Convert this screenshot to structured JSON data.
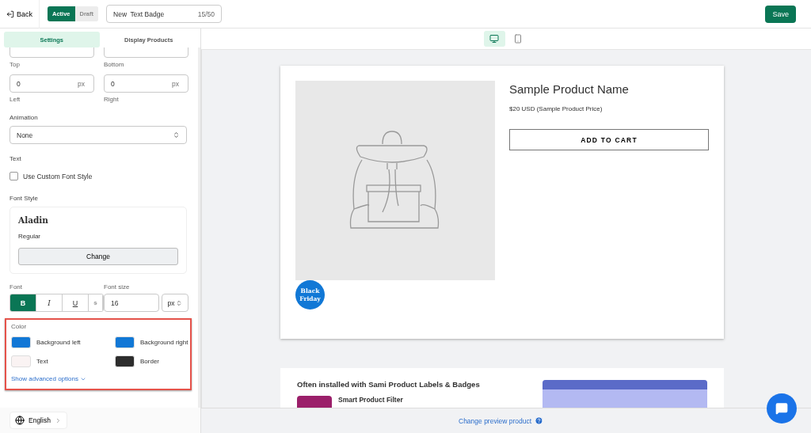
{
  "header": {
    "back": "Back",
    "status": [
      {
        "label": "Active",
        "selected": true
      },
      {
        "label": "Draft",
        "selected": false
      }
    ],
    "name_field": {
      "value": "New  Text Badge",
      "counter": "15/50"
    },
    "save": "Save"
  },
  "sidebar": {
    "tabs": [
      {
        "label": "Settings",
        "selected": true
      },
      {
        "label": "Display Products",
        "selected": false
      }
    ],
    "spacing": [
      {
        "label": "Top"
      },
      {
        "label": "Bottom"
      },
      {
        "label": "Left",
        "value": "0",
        "unit": "px"
      },
      {
        "label": "Right",
        "value": "0",
        "unit": "px"
      }
    ],
    "animation": {
      "label": "Animation",
      "value": "None"
    },
    "text": {
      "heading": "Text",
      "checkbox": {
        "label": "Use Custom Font Style",
        "checked": false
      }
    },
    "font_style": {
      "heading": "Font Style",
      "font": "Aladin",
      "weight": "Regular",
      "button": "Change"
    },
    "font": {
      "label": "Font",
      "formats": [
        {
          "label": "B",
          "kind": "bold",
          "selected": true
        },
        {
          "label": "I",
          "kind": "italic",
          "selected": false
        },
        {
          "label": "U",
          "kind": "underline",
          "selected": false
        },
        {
          "kind": "strike",
          "selected": false
        }
      ]
    },
    "font_size": {
      "label": "Font size",
      "value": "16",
      "unit": "px"
    },
    "color": {
      "heading": "Color",
      "swatches": [
        {
          "label": "Background left",
          "color": "#1178d6"
        },
        {
          "label": "Background right",
          "color": "#1178d6"
        },
        {
          "label": "Text",
          "color": "#faf3f3"
        },
        {
          "label": "Border",
          "color": "#2d2d2d"
        }
      ],
      "advanced": "Show advanced options"
    },
    "language": "English"
  },
  "preview": {
    "devices": [
      {
        "kind": "desktop",
        "selected": true
      },
      {
        "kind": "mobile",
        "selected": false
      }
    ],
    "product": {
      "name": "Sample Product Name",
      "price": "$20 USD (Sample Product Price)",
      "button": "ADD TO CART",
      "badge": "Black Friday"
    },
    "promo": {
      "heading": "Often installed with Sami Product Labels & Badges",
      "app": "Smart Product Filter"
    },
    "footer_link": "Change preview product"
  }
}
